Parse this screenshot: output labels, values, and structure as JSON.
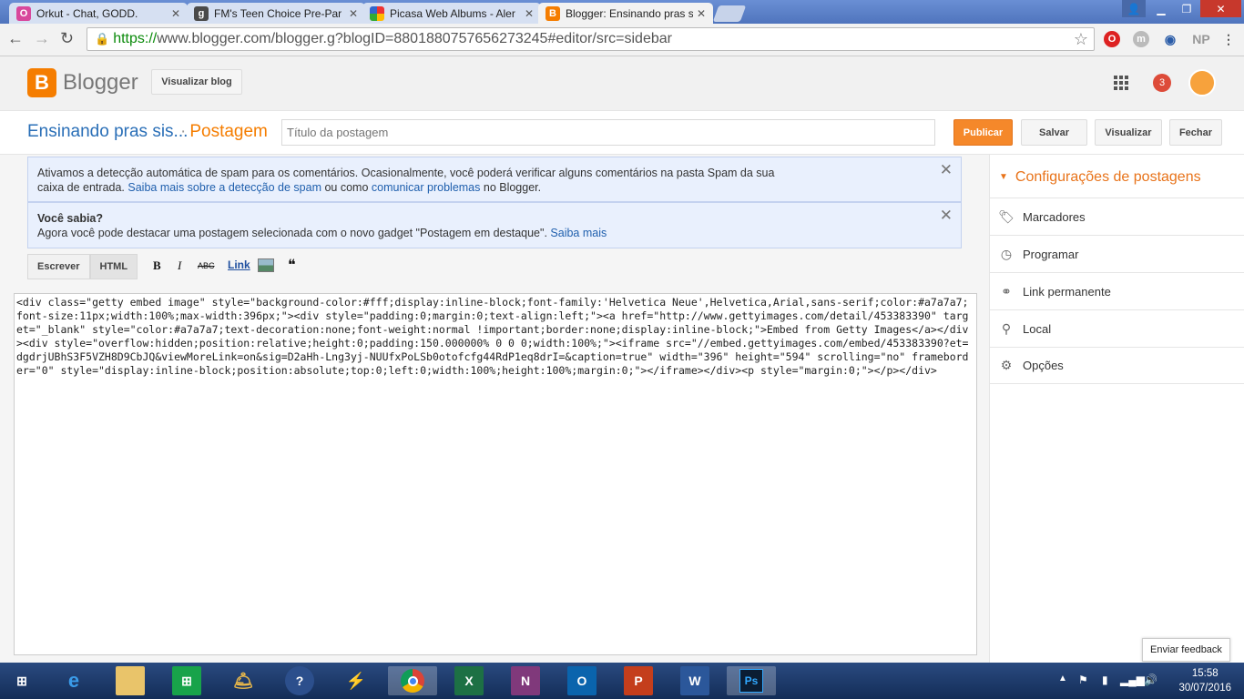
{
  "browser": {
    "tabs": [
      {
        "title": "Orkut - Chat, GODD.",
        "icon": "orkut-icon",
        "color": "#d8479c"
      },
      {
        "title": "FM's Teen Choice Pre-Par",
        "icon": "g-icon",
        "color": "#4a4a4a"
      },
      {
        "title": "Picasa Web Albums - Aler",
        "icon": "picasa-icon",
        "color": "#3c8b3c"
      },
      {
        "title": "Blogger: Ensinando pras s",
        "icon": "blogger-icon",
        "color": "#f57d00"
      }
    ],
    "url_scheme": "https://",
    "url_rest": "www.blogger.com/blogger.g?blogID=8801880757656273245#editor/src=sidebar",
    "extensions": {
      "np_label": "NP",
      "m_label": "m"
    }
  },
  "header": {
    "logo_letter": "B",
    "brand": "Blogger",
    "view_blog_label": "Visualizar blog",
    "notification_count": "3"
  },
  "editor": {
    "blog_name": "Ensinando pras sis...",
    "separator": "·",
    "section": "Postagem",
    "title_placeholder": "Título da postagem",
    "publish_label": "Publicar",
    "save_label": "Salvar",
    "preview_label": "Visualizar",
    "close_label": "Fechar"
  },
  "notices": {
    "spam": {
      "text1": "Ativamos a detecção automática de spam para os comentários. Ocasionalmente, você poderá verificar alguns comentários na pasta Spam da sua",
      "text2": "caixa de entrada. ",
      "link1": "Saiba mais sobre a detecção de spam",
      "text3": " ou como ",
      "link2": "comunicar problemas",
      "text4": " no Blogger."
    },
    "tip": {
      "heading": "Você sabia?",
      "text": "Agora você pode destacar uma postagem selecionada com o novo gadget \"Postagem em destaque\". ",
      "link": "Saiba mais"
    },
    "close_glyph": "✕"
  },
  "toolbar": {
    "compose_label": "Escrever",
    "html_label": "HTML",
    "bold": "B",
    "italic": "I",
    "strike": "ABC",
    "link_label": "Link",
    "quote": "❝"
  },
  "code": "<div class=\"getty embed image\" style=\"background-color:#fff;display:inline-block;font-family:'Helvetica Neue',Helvetica,Arial,sans-serif;color:#a7a7a7;font-size:11px;width:100%;max-width:396px;\"><div style=\"padding:0;margin:0;text-align:left;\"><a href=\"http://www.gettyimages.com/detail/453383390\" target=\"_blank\" style=\"color:#a7a7a7;text-decoration:none;font-weight:normal !important;border:none;display:inline-block;\">Embed from Getty Images</a></div><div style=\"overflow:hidden;position:relative;height:0;padding:150.000000% 0 0 0;width:100%;\"><iframe src=\"//embed.gettyimages.com/embed/453383390?et=dgdrjUBhS3F5VZH8D9CbJQ&viewMoreLink=on&sig=D2aHh-Lng3yj-NUUfxPoLSb0otofcfg44RdP1eq8drI=&caption=true\" width=\"396\" height=\"594\" scrolling=\"no\" frameborder=\"0\" style=\"display:inline-block;position:absolute;top:0;left:0;width:100%;height:100%;margin:0;\"></iframe></div><p style=\"margin:0;\"></p></div>",
  "sidebar": {
    "title": "Configurações de postagens",
    "items": [
      {
        "label": "Marcadores",
        "icon": "tag-icon"
      },
      {
        "label": "Programar",
        "icon": "clock-icon"
      },
      {
        "label": "Link permanente",
        "icon": "link-icon"
      },
      {
        "label": "Local",
        "icon": "location-pin-icon"
      },
      {
        "label": "Opções",
        "icon": "gear-icon"
      }
    ]
  },
  "feedback_label": "Enviar feedback",
  "taskbar": {
    "time": "15:58",
    "date": "30/07/2016",
    "apps": [
      "start-icon",
      "ie-icon",
      "file-explorer-icon",
      "store-icon",
      "bell-app-icon",
      "help-icon",
      "winamp-icon",
      "chrome-icon",
      "excel-icon",
      "onenote-icon",
      "outlook-icon",
      "powerpoint-icon",
      "word-icon",
      "photoshop-icon"
    ]
  },
  "colors": {
    "accent": "#f57d00",
    "link": "#2a6fb7",
    "publish": "#f5882a"
  }
}
